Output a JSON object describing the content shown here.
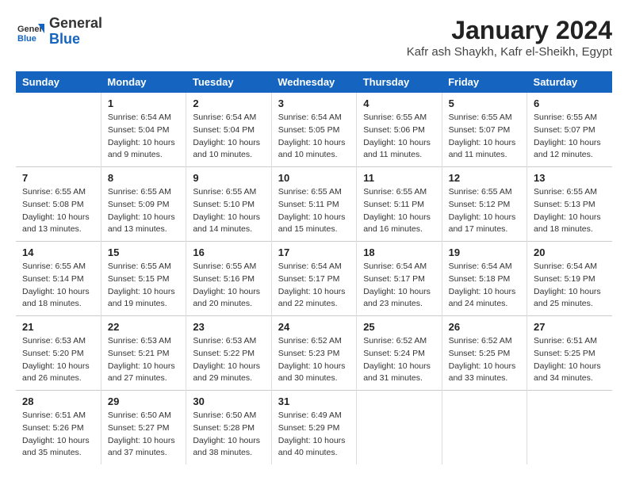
{
  "logo": {
    "line1": "General",
    "line2": "Blue"
  },
  "title": "January 2024",
  "subtitle": "Kafr ash Shaykh, Kafr el-Sheikh, Egypt",
  "weekdays": [
    "Sunday",
    "Monday",
    "Tuesday",
    "Wednesday",
    "Thursday",
    "Friday",
    "Saturday"
  ],
  "weeks": [
    [
      {
        "day": "",
        "sunrise": "",
        "sunset": "",
        "daylight": ""
      },
      {
        "day": "1",
        "sunrise": "6:54 AM",
        "sunset": "5:04 PM",
        "daylight": "10 hours and 9 minutes."
      },
      {
        "day": "2",
        "sunrise": "6:54 AM",
        "sunset": "5:04 PM",
        "daylight": "10 hours and 10 minutes."
      },
      {
        "day": "3",
        "sunrise": "6:54 AM",
        "sunset": "5:05 PM",
        "daylight": "10 hours and 10 minutes."
      },
      {
        "day": "4",
        "sunrise": "6:55 AM",
        "sunset": "5:06 PM",
        "daylight": "10 hours and 11 minutes."
      },
      {
        "day": "5",
        "sunrise": "6:55 AM",
        "sunset": "5:07 PM",
        "daylight": "10 hours and 11 minutes."
      },
      {
        "day": "6",
        "sunrise": "6:55 AM",
        "sunset": "5:07 PM",
        "daylight": "10 hours and 12 minutes."
      }
    ],
    [
      {
        "day": "7",
        "sunrise": "6:55 AM",
        "sunset": "5:08 PM",
        "daylight": "10 hours and 13 minutes."
      },
      {
        "day": "8",
        "sunrise": "6:55 AM",
        "sunset": "5:09 PM",
        "daylight": "10 hours and 13 minutes."
      },
      {
        "day": "9",
        "sunrise": "6:55 AM",
        "sunset": "5:10 PM",
        "daylight": "10 hours and 14 minutes."
      },
      {
        "day": "10",
        "sunrise": "6:55 AM",
        "sunset": "5:11 PM",
        "daylight": "10 hours and 15 minutes."
      },
      {
        "day": "11",
        "sunrise": "6:55 AM",
        "sunset": "5:11 PM",
        "daylight": "10 hours and 16 minutes."
      },
      {
        "day": "12",
        "sunrise": "6:55 AM",
        "sunset": "5:12 PM",
        "daylight": "10 hours and 17 minutes."
      },
      {
        "day": "13",
        "sunrise": "6:55 AM",
        "sunset": "5:13 PM",
        "daylight": "10 hours and 18 minutes."
      }
    ],
    [
      {
        "day": "14",
        "sunrise": "6:55 AM",
        "sunset": "5:14 PM",
        "daylight": "10 hours and 18 minutes."
      },
      {
        "day": "15",
        "sunrise": "6:55 AM",
        "sunset": "5:15 PM",
        "daylight": "10 hours and 19 minutes."
      },
      {
        "day": "16",
        "sunrise": "6:55 AM",
        "sunset": "5:16 PM",
        "daylight": "10 hours and 20 minutes."
      },
      {
        "day": "17",
        "sunrise": "6:54 AM",
        "sunset": "5:17 PM",
        "daylight": "10 hours and 22 minutes."
      },
      {
        "day": "18",
        "sunrise": "6:54 AM",
        "sunset": "5:17 PM",
        "daylight": "10 hours and 23 minutes."
      },
      {
        "day": "19",
        "sunrise": "6:54 AM",
        "sunset": "5:18 PM",
        "daylight": "10 hours and 24 minutes."
      },
      {
        "day": "20",
        "sunrise": "6:54 AM",
        "sunset": "5:19 PM",
        "daylight": "10 hours and 25 minutes."
      }
    ],
    [
      {
        "day": "21",
        "sunrise": "6:53 AM",
        "sunset": "5:20 PM",
        "daylight": "10 hours and 26 minutes."
      },
      {
        "day": "22",
        "sunrise": "6:53 AM",
        "sunset": "5:21 PM",
        "daylight": "10 hours and 27 minutes."
      },
      {
        "day": "23",
        "sunrise": "6:53 AM",
        "sunset": "5:22 PM",
        "daylight": "10 hours and 29 minutes."
      },
      {
        "day": "24",
        "sunrise": "6:52 AM",
        "sunset": "5:23 PM",
        "daylight": "10 hours and 30 minutes."
      },
      {
        "day": "25",
        "sunrise": "6:52 AM",
        "sunset": "5:24 PM",
        "daylight": "10 hours and 31 minutes."
      },
      {
        "day": "26",
        "sunrise": "6:52 AM",
        "sunset": "5:25 PM",
        "daylight": "10 hours and 33 minutes."
      },
      {
        "day": "27",
        "sunrise": "6:51 AM",
        "sunset": "5:25 PM",
        "daylight": "10 hours and 34 minutes."
      }
    ],
    [
      {
        "day": "28",
        "sunrise": "6:51 AM",
        "sunset": "5:26 PM",
        "daylight": "10 hours and 35 minutes."
      },
      {
        "day": "29",
        "sunrise": "6:50 AM",
        "sunset": "5:27 PM",
        "daylight": "10 hours and 37 minutes."
      },
      {
        "day": "30",
        "sunrise": "6:50 AM",
        "sunset": "5:28 PM",
        "daylight": "10 hours and 38 minutes."
      },
      {
        "day": "31",
        "sunrise": "6:49 AM",
        "sunset": "5:29 PM",
        "daylight": "10 hours and 40 minutes."
      },
      {
        "day": "",
        "sunrise": "",
        "sunset": "",
        "daylight": ""
      },
      {
        "day": "",
        "sunrise": "",
        "sunset": "",
        "daylight": ""
      },
      {
        "day": "",
        "sunrise": "",
        "sunset": "",
        "daylight": ""
      }
    ]
  ],
  "labels": {
    "sunrise": "Sunrise:",
    "sunset": "Sunset:",
    "daylight": "Daylight:"
  }
}
